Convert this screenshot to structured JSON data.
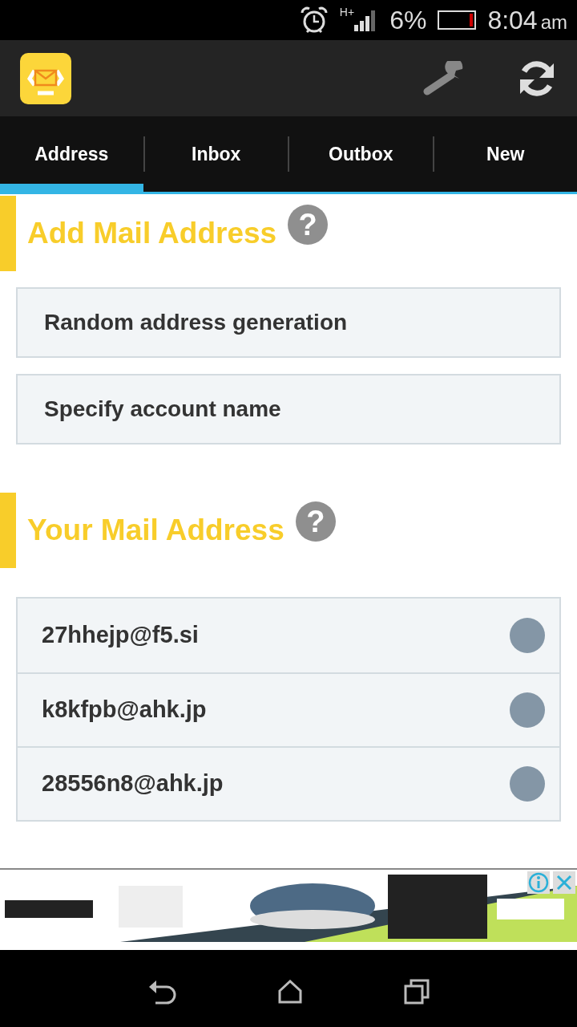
{
  "status_bar": {
    "network": "H+",
    "battery": "6%",
    "time": "8:04",
    "ampm": "am"
  },
  "tabs": [
    {
      "label": "Address",
      "selected": true
    },
    {
      "label": "Inbox",
      "selected": false
    },
    {
      "label": "Outbox",
      "selected": false
    },
    {
      "label": "New",
      "selected": false
    }
  ],
  "sections": [
    {
      "title": "Add Mail Address",
      "help": "?",
      "buttons": [
        "Random address generation",
        "Specify account name"
      ]
    },
    {
      "title": "Your Mail Address",
      "help": "?",
      "addresses": [
        {
          "address": "27hhejp@f5.si",
          "selected": false
        },
        {
          "address": "k8kfpb@ahk.jp",
          "selected": false
        },
        {
          "address": "28556n8@ahk.jp",
          "selected": false
        }
      ]
    }
  ]
}
